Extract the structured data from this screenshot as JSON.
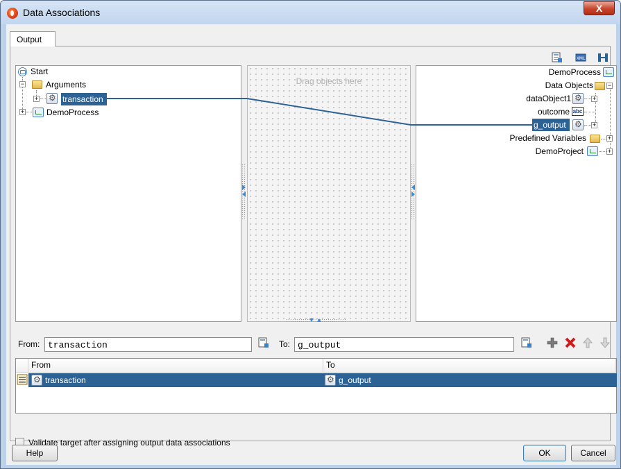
{
  "window": {
    "title": "Data Associations",
    "close_label": "X"
  },
  "tabs": [
    {
      "label": "Output"
    }
  ],
  "left_tree": {
    "start": "Start",
    "arguments": "Arguments",
    "transaction": "transaction",
    "demoprocess": "DemoProcess"
  },
  "middle": {
    "placeholder": "Drag objects here"
  },
  "right_tree": {
    "demoprocess": "DemoProcess",
    "data_objects": "Data Objects",
    "dataobject1": "dataObject1",
    "outcome": "outcome",
    "g_output": "g_output",
    "predefined_variables": "Predefined Variables",
    "demoproject": "DemoProject",
    "abc_icon_text": "abc"
  },
  "mapping": {
    "from_label": "From:",
    "from_value": "transaction",
    "to_label": "To:",
    "to_value": "g_output"
  },
  "table": {
    "headers": [
      "From",
      "To"
    ],
    "rows": [
      {
        "from": "transaction",
        "to": "g_output"
      }
    ]
  },
  "validate_label": "Validate target after assigning output data associations",
  "buttons": {
    "help": "Help",
    "ok": "OK",
    "cancel": "Cancel"
  },
  "icons": [
    "start-icon",
    "folder-icon",
    "gear-icon",
    "process-icon",
    "abc-icon",
    "add-icon",
    "delete-icon",
    "move-up-icon",
    "move-down-icon",
    "expression-builder-icon",
    "xml-icon",
    "auto-map-icon"
  ],
  "colors": {
    "selection": "#2d6295",
    "mapping_line": "#2d6295",
    "delete": "#d11a1a",
    "add": "#6f6f6f"
  }
}
